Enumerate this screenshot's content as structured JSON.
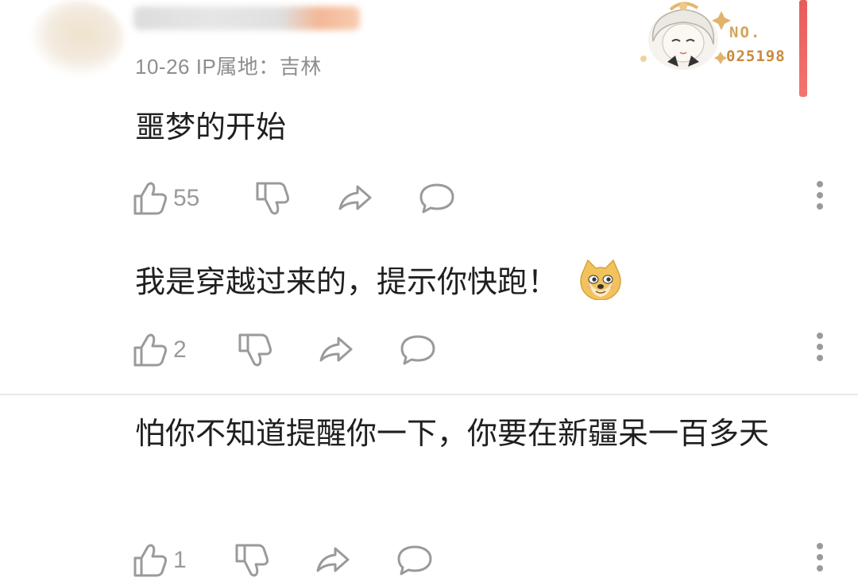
{
  "header": {
    "meta": "10-26 IP属地：吉林"
  },
  "badge": {
    "no_label": "NO.",
    "number": "025198"
  },
  "comments": [
    {
      "text": "噩梦的开始",
      "likes": "55",
      "emoji": ""
    },
    {
      "text": "我是穿越过来的，提示你快跑！",
      "likes": "2",
      "emoji": "doge-emoji"
    },
    {
      "text": "怕你不知道提醒你一下，你要在新疆呆一百多天",
      "likes": "1",
      "emoji": ""
    }
  ],
  "icons": {
    "like": "thumbs-up-icon",
    "dislike": "thumbs-down-icon",
    "share": "share-icon",
    "reply": "comment-icon",
    "more": "more-vertical-icon"
  },
  "colors": {
    "icon_gray": "#9a9a9a",
    "text": "#1f1f1f",
    "meta": "#8e8e8e"
  }
}
